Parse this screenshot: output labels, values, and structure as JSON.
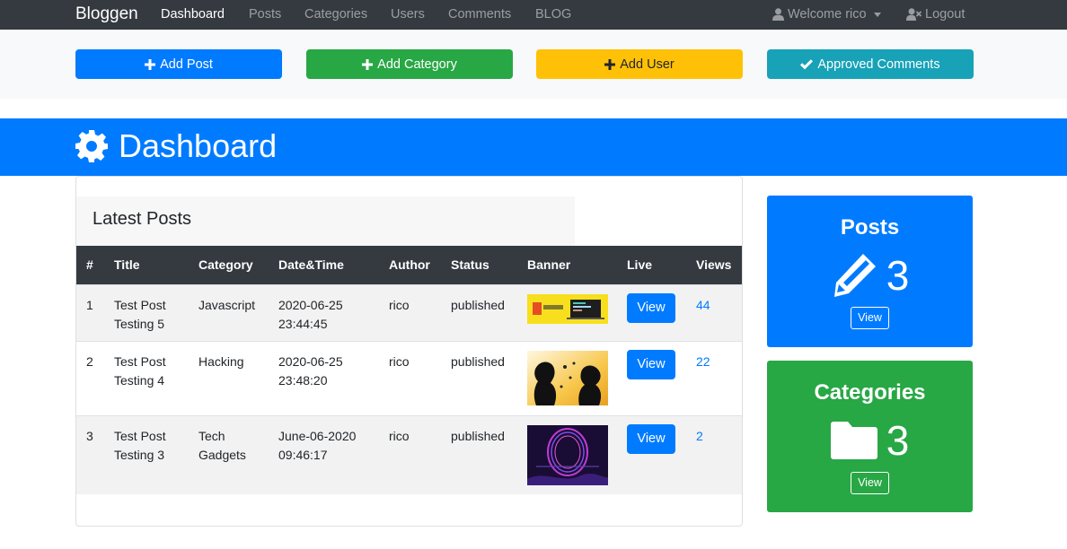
{
  "navbar": {
    "brand": "Bloggen",
    "items": [
      "Dashboard",
      "Posts",
      "Categories",
      "Users",
      "Comments",
      "BLOG"
    ],
    "welcome": "Welcome rico",
    "logout": "Logout"
  },
  "actions": {
    "add_post": "Add Post",
    "add_category": "Add Category",
    "add_user": "Add User",
    "approved_comments": "Approved Comments"
  },
  "header": {
    "title": "Dashboard"
  },
  "latest": {
    "title": "Latest Posts",
    "columns": [
      "#",
      "Title",
      "Category",
      "Date&Time",
      "Author",
      "Status",
      "Banner",
      "Live",
      "Views"
    ],
    "rows": [
      {
        "num": "1",
        "title_l1": "Test Post",
        "title_l2": "Testing 5",
        "cat_l1": "Javascript",
        "cat_l2": "",
        "date_l1": "2020-06-25",
        "date_l2": "23:44:45",
        "author": "rico",
        "status": "published",
        "banner": "javascript-banner",
        "live": "View",
        "views": "44"
      },
      {
        "num": "2",
        "title_l1": "Test Post",
        "title_l2": "Testing 4",
        "cat_l1": "Hacking",
        "cat_l2": "",
        "date_l1": "2020-06-25",
        "date_l2": "23:48:20",
        "author": "rico",
        "status": "published",
        "banner": "silhouette-banner",
        "live": "View",
        "views": "22"
      },
      {
        "num": "3",
        "title_l1": "Test Post",
        "title_l2": "Testing 3",
        "cat_l1": "Tech",
        "cat_l2": "Gadgets",
        "date_l1": "June-06-2020",
        "date_l2": "09:46:17",
        "author": "rico",
        "status": "published",
        "banner": "abstract-banner",
        "live": "View",
        "views": "2"
      }
    ]
  },
  "stats": {
    "posts": {
      "title": "Posts",
      "count": "3",
      "button": "View",
      "icon": "pencil-icon"
    },
    "categories": {
      "title": "Categories",
      "count": "3",
      "button": "View",
      "icon": "folder-icon"
    }
  },
  "colors": {
    "primary": "#007bff",
    "success": "#28a745",
    "warning": "#ffc107",
    "info": "#17a2b8",
    "dark": "#343a40"
  }
}
